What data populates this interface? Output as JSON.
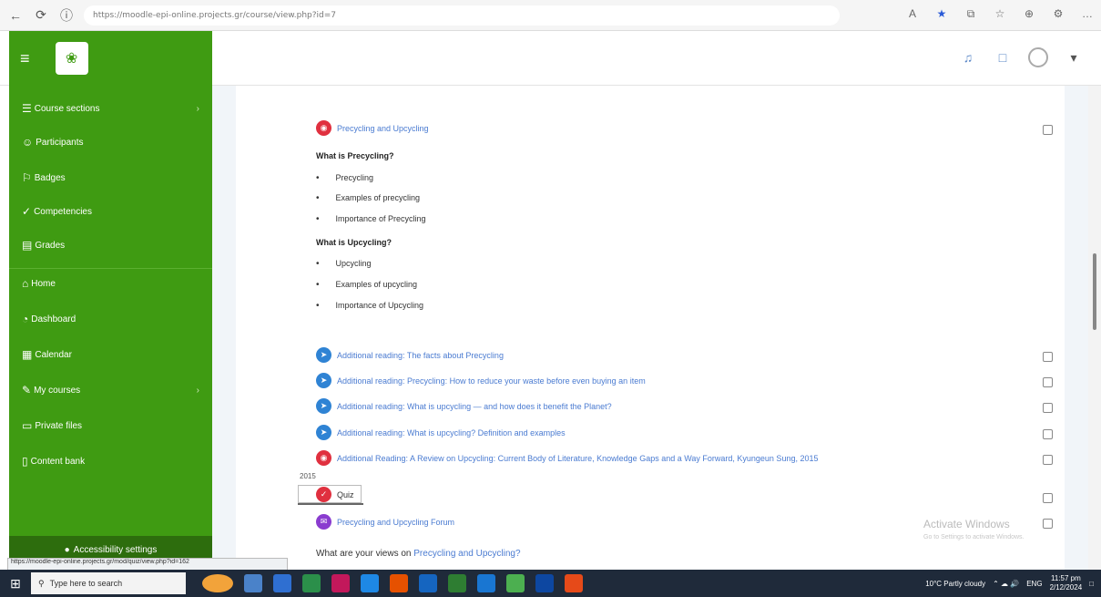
{
  "browser": {
    "url": "https://moodle-epi-online.projects.gr/course/view.php?id=7",
    "nav": {
      "back_icon": "←",
      "refresh_icon": "⟳",
      "site_info_icon": "ⓘ"
    },
    "right_icons": [
      "A",
      "★",
      "⧉",
      "☆",
      "⊕",
      "⚙",
      "…"
    ]
  },
  "header": {
    "menu_icon": "≡",
    "logo_text": "❀"
  },
  "sidebar": {
    "items": [
      {
        "label": "Course sections",
        "icon": "☰"
      },
      {
        "label": "Participants",
        "icon": "☺"
      },
      {
        "label": "Badges",
        "icon": "⚐"
      },
      {
        "label": "Competencies",
        "icon": "✓"
      },
      {
        "label": "Grades",
        "icon": "▤"
      },
      {
        "label": "Home",
        "icon": "⌂"
      },
      {
        "label": "Dashboard",
        "icon": "◔"
      },
      {
        "label": "Calendar",
        "icon": "▦"
      },
      {
        "label": "My courses",
        "icon": "✎"
      },
      {
        "label": "Private files",
        "icon": "▭"
      },
      {
        "label": "Content bank",
        "icon": "▯"
      }
    ],
    "accessibility": "Accessibility settings"
  },
  "content": {
    "main_activity": "Precycling and Upcycling",
    "what_precycling": "What is Precycling?",
    "precycling_items": [
      "Precycling",
      "Examples of precycling",
      "Importance of Precycling"
    ],
    "what_upcycling": "What is Upcycling?",
    "upcycling_items": [
      "Upcycling",
      "Examples of upcycling",
      "Importance of Upcycling"
    ],
    "readings": [
      "Additional reading: The facts about Precycling",
      "Additional reading: Precycling: How to reduce your waste before even buying an item",
      "Additional reading: What is upcycling — and how does it benefit the Planet?",
      "Additional reading: What is upcycling? Definition and examples",
      "Additional Reading: A Review on Upcycling: Current Body of Literature, Knowledge Gaps and a Way Forward, Kyungeun Sung, 2015"
    ],
    "number_label": "2015",
    "quiz": "Quiz",
    "forum": "Precycling and Upcycling Forum",
    "forum_question_prefix": "What are your views on ",
    "forum_question_link": "Precycling and Upcycling?"
  },
  "watermark": {
    "title": "Activate Windows",
    "sub": "Go to Settings to activate Windows."
  },
  "status_link": "https://moodle-epi-online.projects.gr/mod/quiz/view.php?id=162",
  "taskbar": {
    "search_placeholder": "Type here to search",
    "weather": "10°C Partly cloudy",
    "time": "11:57 pm",
    "date": "2/12/2024",
    "lang": "ENG"
  }
}
